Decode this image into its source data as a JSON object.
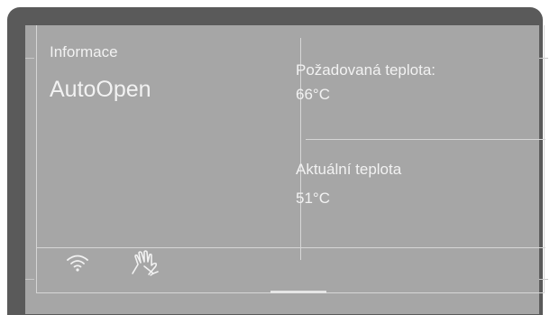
{
  "header": {
    "section_label": "Informace",
    "program_name": "AutoOpen"
  },
  "temperatures": {
    "target_label": "Požadovaná teplota:",
    "target_value": "66°C",
    "current_label": "Aktuální teplota",
    "current_value": "51°C"
  },
  "status_bar": {
    "icons": [
      "wifi-icon",
      "touch-hand-icon"
    ]
  },
  "colors": {
    "screen_background": "#a6a6a6",
    "text": "#f2f2f2",
    "frame": "#5a5a5a"
  }
}
